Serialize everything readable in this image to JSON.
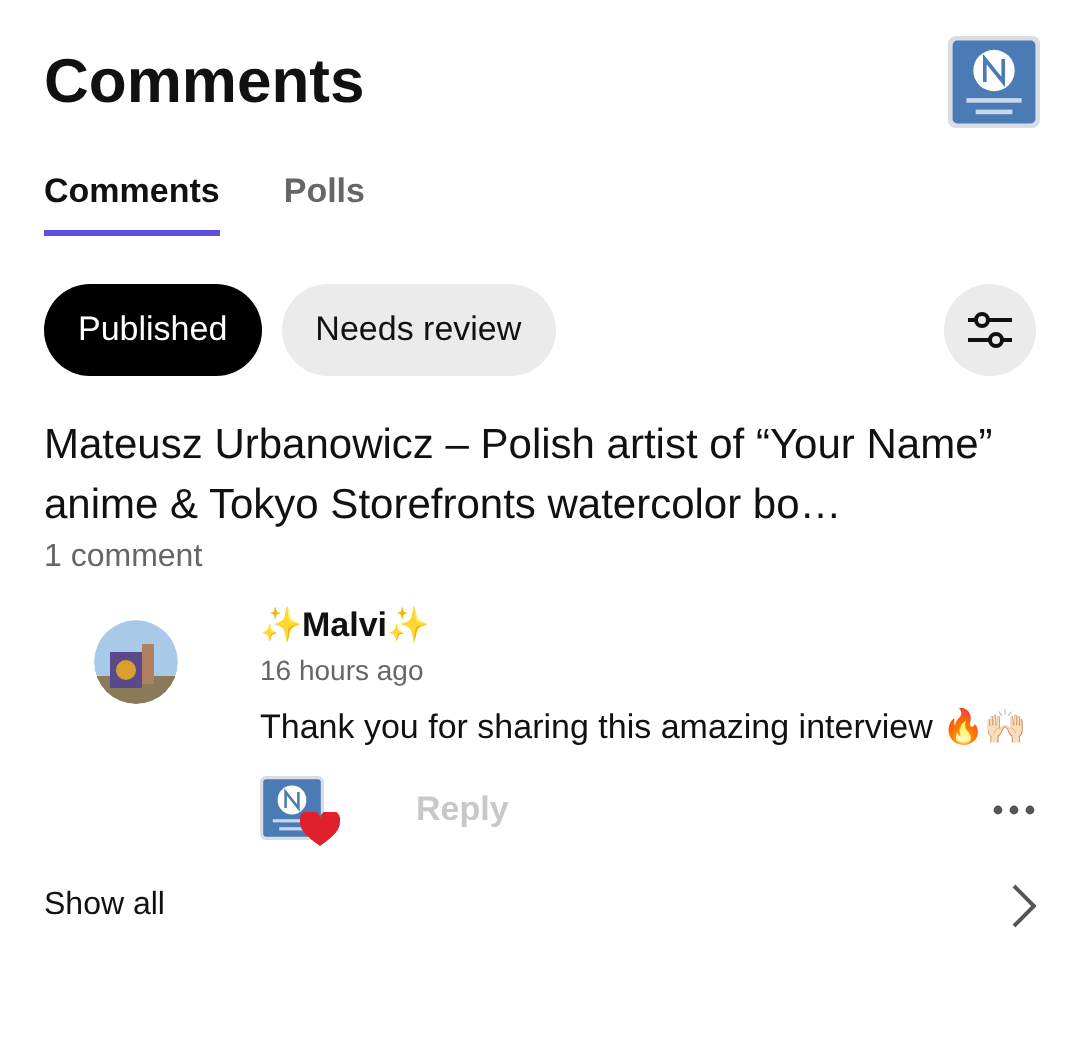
{
  "header": {
    "title": "Comments"
  },
  "tabs": [
    {
      "label": "Comments",
      "selected": true
    },
    {
      "label": "Polls",
      "selected": false
    }
  ],
  "filters": [
    {
      "label": "Published",
      "selected": true
    },
    {
      "label": "Needs review",
      "selected": false
    }
  ],
  "post": {
    "title": "Mateusz Urbanowicz – Polish artist of “Your Name” anime & Tokyo Storefronts watercolor bo…",
    "count": "1 comment",
    "comments": [
      {
        "author": "✨Malvi✨",
        "time": "16 hours ago",
        "text": "Thank you for sharing this amazing interview 🔥🙌🏻",
        "liked": true,
        "reply": "Reply"
      }
    ]
  },
  "footer": {
    "label": "Show all"
  }
}
